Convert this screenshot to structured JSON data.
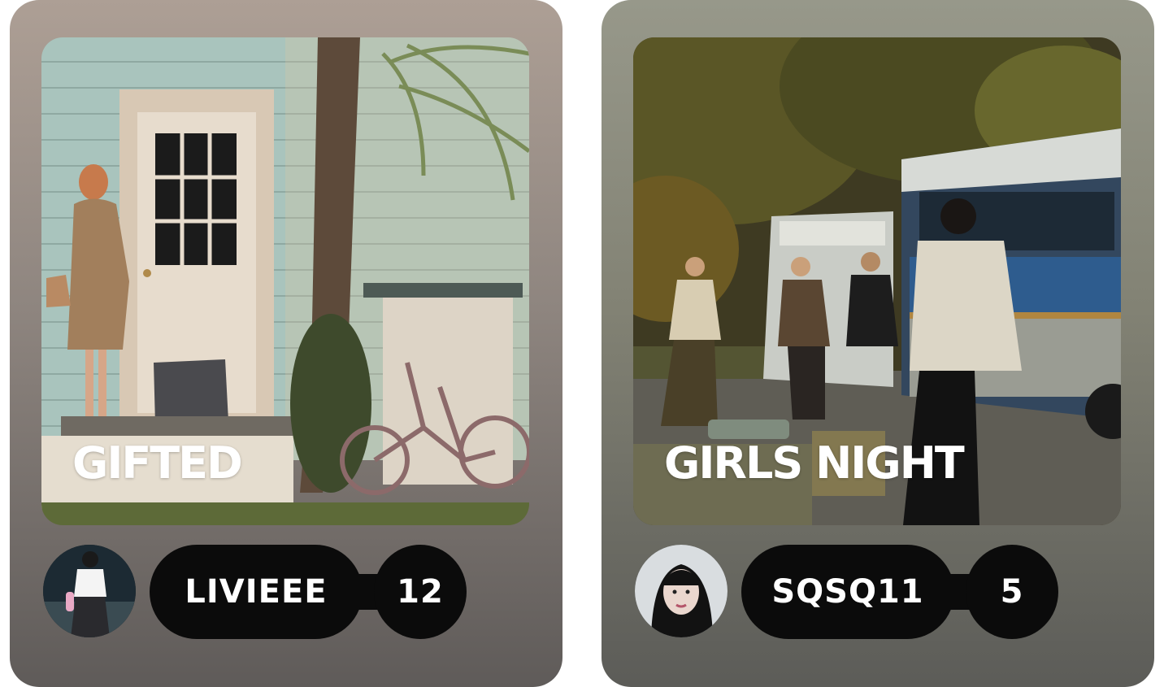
{
  "cards": [
    {
      "title": "GIFTED",
      "username": "LIVIEEE",
      "count": "12"
    },
    {
      "title": "GIRLS NIGHT",
      "username": "SQSQ11",
      "count": "5"
    }
  ],
  "colors": {
    "pill": "#0b0b0b",
    "text": "#ffffff",
    "card1_top": "#ad9f95",
    "card2_top": "#97988a"
  },
  "icons": {
    "avatar_1": "user-avatar",
    "avatar_2": "user-avatar"
  }
}
